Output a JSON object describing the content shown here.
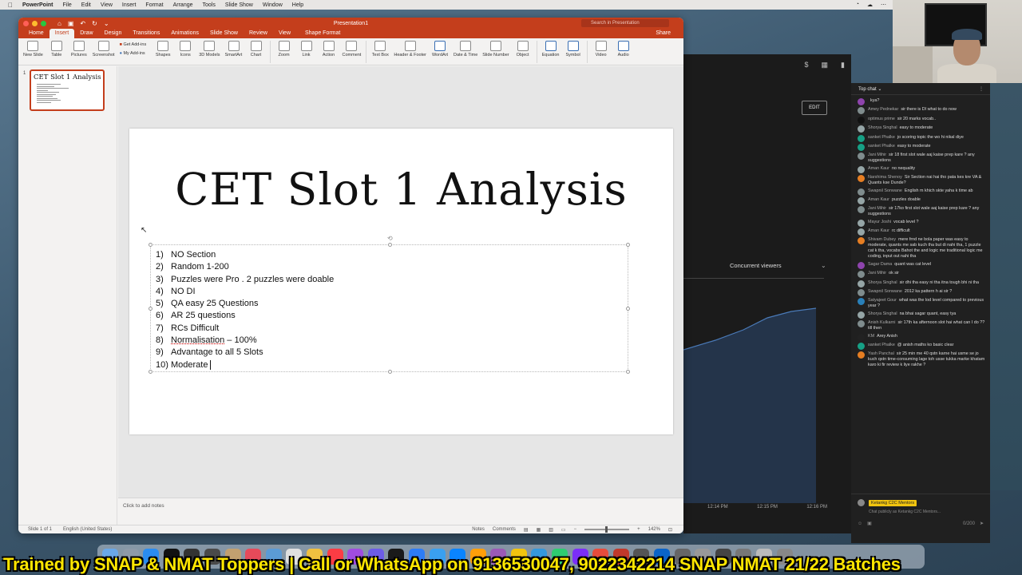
{
  "menubar": {
    "app": "PowerPoint",
    "items": [
      "File",
      "Edit",
      "View",
      "Insert",
      "Format",
      "Arrange",
      "Tools",
      "Slide Show",
      "Window",
      "Help"
    ]
  },
  "window": {
    "title": "Presentation1",
    "search_placeholder": "Search in Presentation",
    "share": "Share",
    "tabs": [
      "Home",
      "Insert",
      "Draw",
      "Design",
      "Transitions",
      "Animations",
      "Slide Show",
      "Review",
      "View"
    ],
    "active_tab": "Insert",
    "context_tab": "Shape Format"
  },
  "ribbon": {
    "new_slide": "New Slide",
    "table": "Table",
    "pictures": "Pictures",
    "screenshot": "Screenshot",
    "get_addins": "Get Add-ins",
    "my_addins": "My Add-ins",
    "shapes": "Shapes",
    "icons": "Icons",
    "models": "3D Models",
    "smartart": "SmartArt",
    "chart": "Chart",
    "zoom": "Zoom",
    "link": "Link",
    "action": "Action",
    "comment": "Comment",
    "textbox": "Text Box",
    "header_footer": "Header & Footer",
    "wordart": "WordArt",
    "date_time": "Date & Time",
    "slide_number": "Slide Number",
    "object": "Object",
    "equation": "Equation",
    "symbol": "Symbol",
    "video": "Video",
    "audio": "Audio"
  },
  "thumbnail": {
    "number": "1",
    "title": "CET Slot 1 Analysis"
  },
  "slide": {
    "title": "CET Slot 1 Analysis",
    "items": [
      {
        "n": "1)",
        "text": "NO Section"
      },
      {
        "n": "2)",
        "text": "Random 1-200"
      },
      {
        "n": "3)",
        "text": "Puzzles were Pro . 2 puzzles were doable"
      },
      {
        "n": "4)",
        "text": "NO DI"
      },
      {
        "n": "5)",
        "text": "QA easy 25 Questions"
      },
      {
        "n": "6)",
        "text": "AR 25 questions"
      },
      {
        "n": "7)",
        "text": "RCs Difficult"
      },
      {
        "n": "8)",
        "text": "Normalisation"
      },
      {
        "n": "9)",
        "text": "Advantage to all 5 Slots"
      },
      {
        "n": "10)",
        "text": "Moderate"
      }
    ],
    "item8_suffix": " – 100%"
  },
  "notes_placeholder": "Click to add notes",
  "status": {
    "slide": "Slide 1 of 1",
    "language": "English (United States)",
    "notes": "Notes",
    "comments": "Comments",
    "zoom": "142%"
  },
  "studio": {
    "edit": "EDIT",
    "concurrent": "Concurrent viewers",
    "times": [
      "12:14 PM",
      "12:15 PM",
      "12:16 PM"
    ]
  },
  "chat": {
    "header": "Top chat",
    "messages": [
      {
        "author": "",
        "text": "kya?",
        "color": "#8e44ad"
      },
      {
        "author": "Amey Pednekar",
        "text": "sir there is DI what to do now",
        "color": "#7f8c8d"
      },
      {
        "author": "optimus prime",
        "text": "sir 20 marks vocab..",
        "color": "#111111"
      },
      {
        "author": "Shorya Singhal",
        "text": "easy to moderate",
        "color": "#95a5a6"
      },
      {
        "author": "sanket Phalke",
        "text": "jo scoring topic the wo hi nikal diye",
        "color": "#16a085"
      },
      {
        "author": "sanket Phalke",
        "text": "easy to moderate",
        "color": "#16a085"
      },
      {
        "author": "Jani Mihir",
        "text": "sir 18 first slot wale aaj kaise prep kare ? any suggestions",
        "color": "#7f8c8d"
      },
      {
        "author": "Aman Kaur",
        "text": "no nequality",
        "color": "#95a5a6"
      },
      {
        "author": "Narshima Shenoy",
        "text": "Sir Section nai hai tho pata kes kre VA & Quants kse Dunde?",
        "color": "#e67e22"
      },
      {
        "author": "Swapnil Sonwane",
        "text": "English m khich skte yaha k time ab",
        "color": "#7f8c8d"
      },
      {
        "author": "Aman Kaur",
        "text": "puzzles doable",
        "color": "#95a5a6"
      },
      {
        "author": "Jani Mihir",
        "text": "sir 17ko first slot wale aaj kaise prep kare ? any suggestions",
        "color": "#7f8c8d"
      },
      {
        "author": "Mayur Joshi",
        "text": "vocab level ?",
        "color": "#95a5a6"
      },
      {
        "author": "Aman Kaur",
        "text": "rc difficult",
        "color": "#95a5a6"
      },
      {
        "author": "Shivam Dubey",
        "text": "mere frnd ne bola paper was easy to moderate, quants me sab kuch tha but di nahi tha, 1 puzzle cat k tha, vocabs Bahot the and logic me traditional logic me coding, input out nahi tha",
        "color": "#e67e22"
      },
      {
        "author": "Sagar Dama",
        "text": "quant was cat level",
        "color": "#8e44ad"
      },
      {
        "author": "Jani Mihir",
        "text": "ok sir",
        "color": "#7f8c8d"
      },
      {
        "author": "Shorya Singhal",
        "text": "sir dhi tha easy ni tha itna tough bhi ni tha",
        "color": "#95a5a6"
      },
      {
        "author": "Swapnil Sonwane",
        "text": "2012 ka pattern h ai sir ?",
        "color": "#7f8c8d"
      },
      {
        "author": "Satyajeet Gour",
        "text": "what was the lod level compared to previous year ?",
        "color": "#2980b9"
      },
      {
        "author": "Shorya Singhal",
        "text": "na bhai sagar quant, easy tya",
        "color": "#95a5a6"
      },
      {
        "author": "Anish Kulkarni",
        "text": "sir 17th ka afternoon slot hai what can I do ?? till then",
        "color": "#7f8c8d"
      },
      {
        "author": "KM",
        "text": "Arey Anish",
        "color": "#222222"
      },
      {
        "author": "sanket Phalke",
        "text": "@ anish maths ko basic clear",
        "color": "#16a085"
      },
      {
        "author": "Yash Panchal",
        "text": "sir 25 min me 40 qstn karne hai usme se jo kuch qstn time-consuming lage toh usse tukka marke khatam karo ki fir review k liye rakhe ?",
        "color": "#e67e22"
      }
    ],
    "mentor_badge": "Ketankg C2C Mentors",
    "chat_as": "Chat publicly as Ketankg C2C Mentors...",
    "counter": "0/200"
  },
  "banner": "Trained by SNAP & NMAT Toppers | Call or WhatsApp on 9136530047, 9022342214   SNAP NMAT 21/22 Batches"
}
